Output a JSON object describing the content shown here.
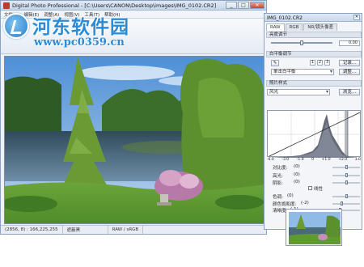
{
  "main_window": {
    "title": "Digital Photo Professional - [C:\\Users\\CANON\\Desktop\\images\\IMG_0102.CR2]",
    "controls": {
      "minimize": "_",
      "maximize": "□",
      "close": "✕"
    },
    "menu": [
      "文件(F)",
      "编辑(E)",
      "调整(A)",
      "视图(V)",
      "工具(T)",
      "帮助(H)"
    ]
  },
  "watermark": {
    "title": "河东软件园",
    "url": "www.pc0359.cn"
  },
  "status_bar": {
    "coords": "(2856, 8) : 166,225,255",
    "mode": "遮蔽黑",
    "profile": "RAW / sRGB"
  },
  "tool_panel": {
    "title": "IMG_0102.CR2",
    "close": "✕",
    "tabs": [
      "RAW",
      "RGB",
      "NR/镜头像差"
    ],
    "brightness": {
      "label": "亮度调节",
      "value": "0.00"
    },
    "white_balance": {
      "label": "白平衡调节",
      "eyedropper_icon": "eyedropper-icon",
      "presets": [
        "1",
        "2",
        "3"
      ],
      "register_button": "记录...",
      "mode": "单击白平衡",
      "adjust_button": "调整..."
    },
    "picture_style": {
      "label": "照片样式",
      "value": "风光",
      "browse_button": "浏览..."
    },
    "histogram": {
      "ticks": [
        "-6.0",
        "-3.0",
        "-1.0",
        "0",
        "+1.0",
        "+2.0",
        "3.0"
      ]
    },
    "adjustments": [
      {
        "label": "对比度:",
        "value": "(0)"
      },
      {
        "label": "高光:",
        "value": "(0)"
      },
      {
        "label": "阴影:",
        "value": "(0)"
      }
    ],
    "linear_label": "线性",
    "color_adjustments": [
      {
        "label": "色调:",
        "value": "(0)"
      },
      {
        "label": "颜色饱和度:",
        "value": "(-2)"
      },
      {
        "label": "清晰度:",
        "value": "(-1)"
      }
    ]
  }
}
